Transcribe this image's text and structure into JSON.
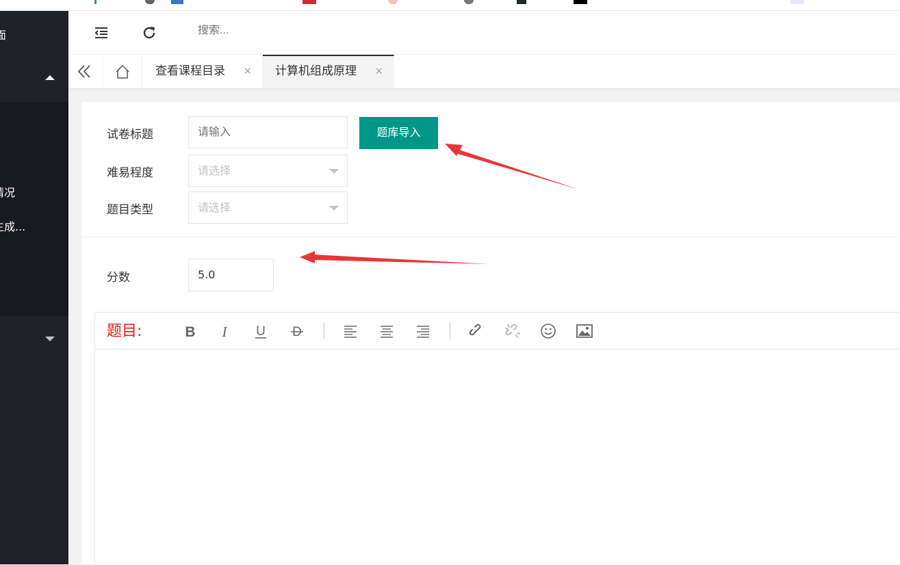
{
  "sidebar": {
    "top_text": "面",
    "sub_items": [
      "情况",
      "生成..."
    ]
  },
  "header": {
    "search_placeholder": "搜索..."
  },
  "tabs": [
    {
      "label": "查看课程目录",
      "close": "×",
      "active": false
    },
    {
      "label": "计算机组成原理",
      "close": "×",
      "active": true
    }
  ],
  "form": {
    "title_label": "试卷标题",
    "title_placeholder": "请输入",
    "import_button": "题库导入",
    "difficulty_label": "难易程度",
    "difficulty_value": "请选择",
    "type_label": "题目类型",
    "type_value": "请选择",
    "score_label": "分数",
    "score_value": "5.0"
  },
  "editor": {
    "question_label": "题目:",
    "tools": [
      "bold-icon",
      "italic-icon",
      "underline-icon",
      "strikethrough-icon",
      "align-left-icon",
      "align-center-icon",
      "align-right-icon",
      "link-icon",
      "unlink-icon",
      "emoji-icon",
      "image-icon"
    ]
  },
  "colors": {
    "sidebar_bg": "#20222a",
    "primary_button": "#009688",
    "annotation_arrow": "#e8353a",
    "question_label": "#e01c1c"
  }
}
